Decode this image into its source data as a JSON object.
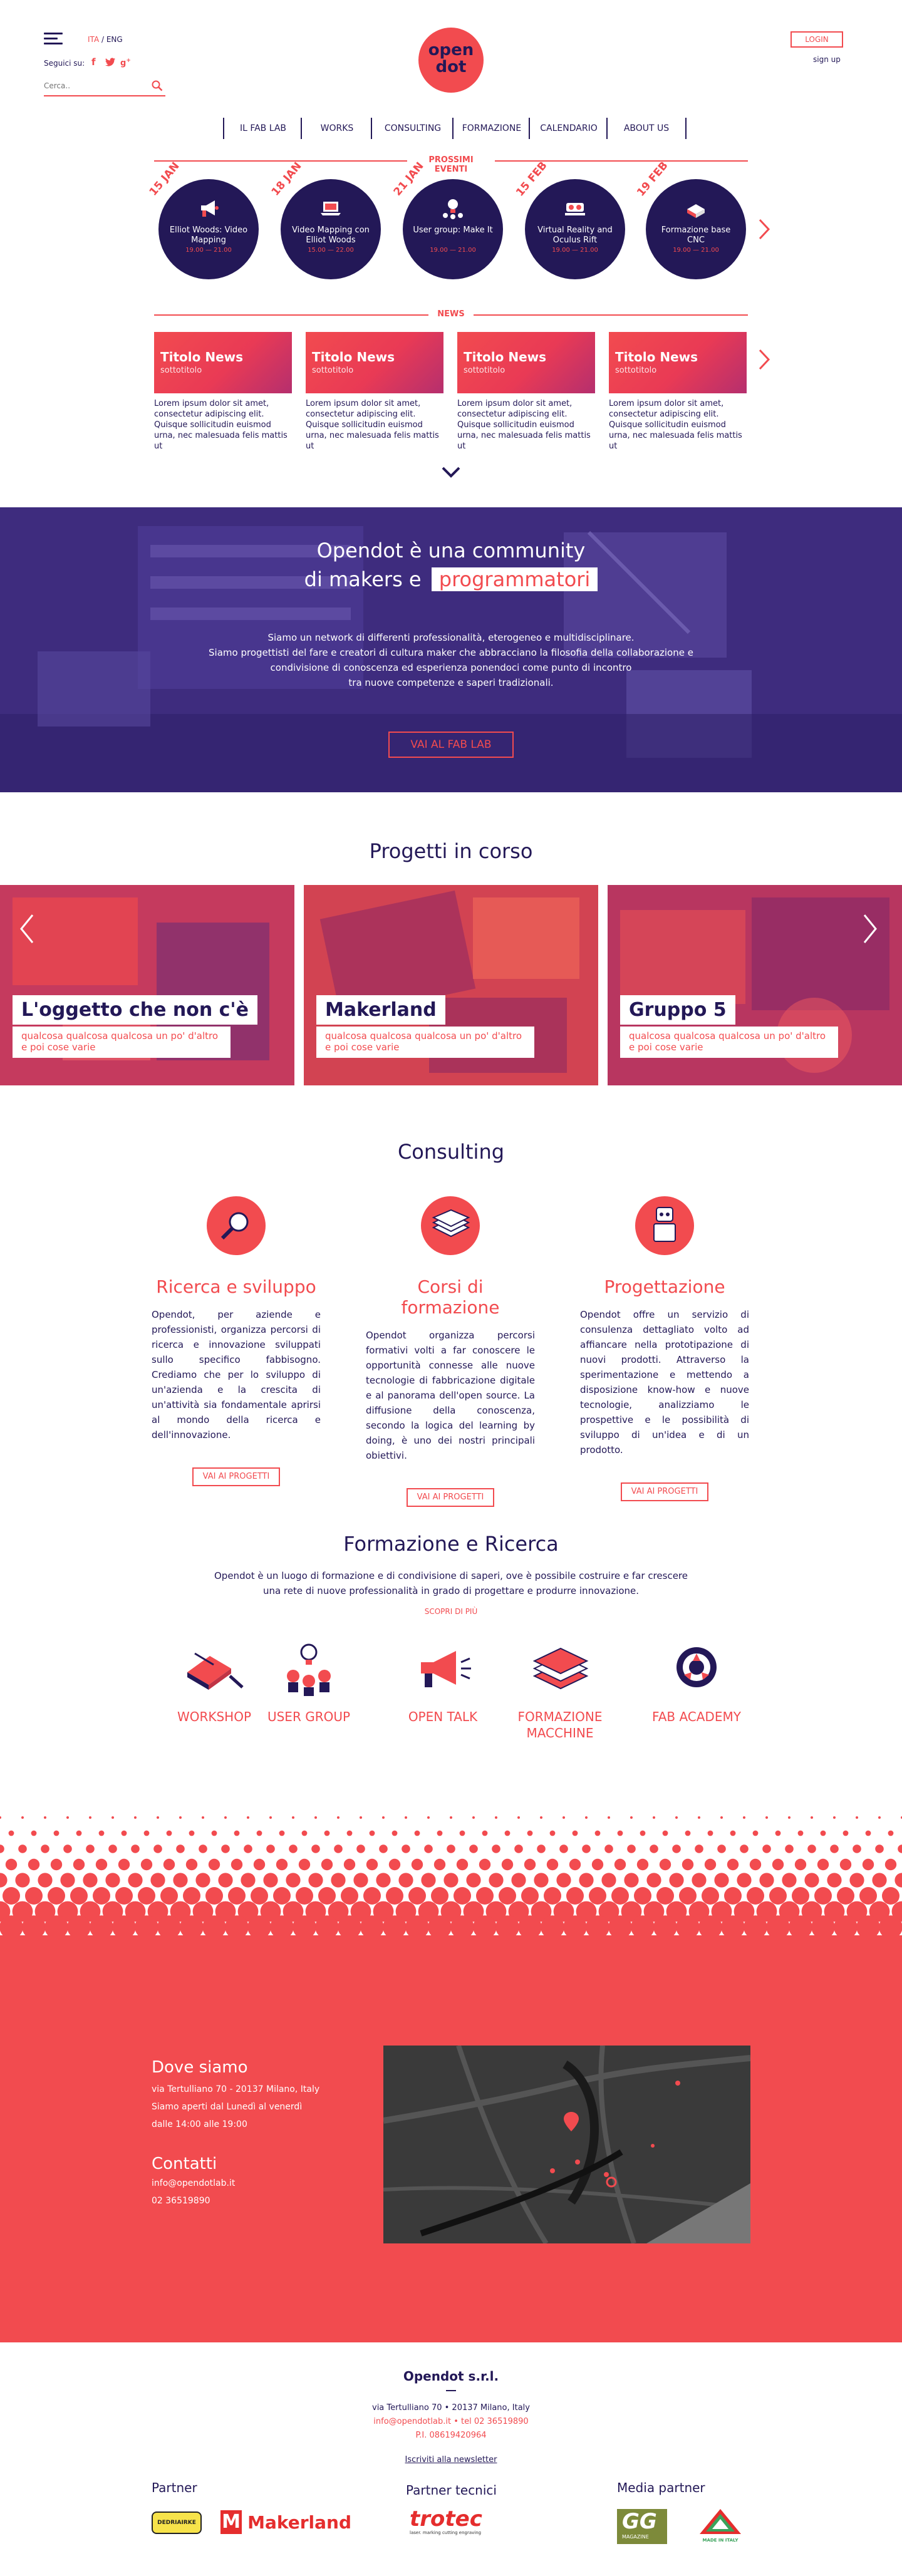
{
  "header": {
    "lang_ita": "ITA",
    "lang_sep": " / ",
    "lang_eng": "ENG",
    "follow_label": "Seguici su:",
    "search_placeholder": "Cerca..",
    "logo_line1": "open",
    "logo_line2": "dot",
    "login_label": "LOGIN",
    "signup_label": "sign up"
  },
  "nav": {
    "items": [
      "IL FAB LAB",
      "WORKS",
      "CONSULTING",
      "FORMAZIONE",
      "CALENDARIO",
      "ABOUT US"
    ]
  },
  "events": {
    "section_label": "PROSSIMI EVENTI",
    "items": [
      {
        "date": "15 JAN",
        "title": "Elliot Woods: Video Mapping",
        "time": "19.00 — 21.00"
      },
      {
        "date": "18 JAN",
        "title": "Video Mapping con Elliot Woods",
        "time": "15.00 — 22.00"
      },
      {
        "date": "21 JAN",
        "title": "User group: Make It",
        "time": "19.00 — 21.00"
      },
      {
        "date": "15 FEB",
        "title": "Virtual Reality and Oculus Rift",
        "time": "19.00 — 21.00"
      },
      {
        "date": "19 FEB",
        "title": "Formazione base CNC",
        "time": "19.00 — 21.00"
      }
    ]
  },
  "news": {
    "section_label": "NEWS",
    "items": [
      {
        "title": "Titolo News",
        "subtitle": "sottotitolo",
        "text": "Lorem ipsum dolor sit amet, consectetur adipiscing elit. Quisque sollicitudin euismod urna, nec malesuada felis mattis ut"
      },
      {
        "title": "Titolo News",
        "subtitle": "sottotitolo",
        "text": "Lorem ipsum dolor sit amet, consectetur adipiscing elit. Quisque sollicitudin euismod urna, nec malesuada felis mattis ut"
      },
      {
        "title": "Titolo News",
        "subtitle": "sottotitolo",
        "text": "Lorem ipsum dolor sit amet, consectetur adipiscing elit. Quisque sollicitudin euismod urna, nec malesuada felis mattis ut"
      },
      {
        "title": "Titolo News",
        "subtitle": "sottotitolo",
        "text": "Lorem ipsum dolor sit amet, consectetur adipiscing elit. Quisque sollicitudin euismod urna, nec malesuada felis mattis ut"
      }
    ]
  },
  "hero": {
    "title_line1": "Opendot è una community",
    "title_line2_prefix": "di makers e",
    "title_highlight": "programmatori",
    "text_line1": "Siamo un network di differenti professionalità, eterogeneo e multidisciplinare.",
    "text_line2": "Siamo progettisti del fare e creatori di cultura maker che abbracciano la filosofia della collaborazione e",
    "text_line3": "condivisione di conoscenza ed esperienza ponendoci come punto di incontro",
    "text_line4": "tra nuove competenze e saperi tradizionali.",
    "button_label": "VAI AL FAB LAB"
  },
  "projects": {
    "title": "Progetti in corso",
    "items": [
      {
        "name": "L'oggetto che non c'è",
        "desc": "qualcosa qualcosa qualcosa un po' d'altro e poi cose varie"
      },
      {
        "name": "Makerland",
        "desc": "qualcosa qualcosa qualcosa un po' d'altro e poi cose varie"
      },
      {
        "name": "Gruppo 5",
        "desc": "qualcosa qualcosa qualcosa un po' d'altro e poi cose varie"
      }
    ]
  },
  "consulting": {
    "title": "Consulting",
    "items": [
      {
        "title": "Ricerca e sviluppo",
        "text": "Opendot, per aziende e professionisti, organizza percorsi di ricerca e innovazione sviluppati sullo specifico fabbisogno. Crediamo che per lo sviluppo di un'azienda e la crescita di un'attività sia fondamentale aprirsi al mondo della ricerca e dell'innovazione.",
        "button": "VAI AI PROGETTI"
      },
      {
        "title": "Corsi di formazione",
        "text": "Opendot organizza percorsi formativi volti a far conoscere le opportunità connesse alle nuove tecnologie di fabbricazione digitale e al panorama dell'open source. La diffusione della conoscenza, secondo la logica del learning by doing, è uno dei nostri principali obiettivi.",
        "button": "VAI AI PROGETTI"
      },
      {
        "title": "Progettazione",
        "text": "Opendot offre un servizio di consulenza dettagliato volto ad affiancare nella prototipazione di nuovi prodotti. Attraverso la sperimentazione e mettendo a disposizione know-how e nuove tecnologie, analizziamo le prospettive e le possibilità di sviluppo di un'idea e di un prodotto.",
        "button": "VAI AI PROGETTI"
      }
    ]
  },
  "formazione": {
    "title": "Formazione e Ricerca",
    "text_line1": "Opendot è un luogo di formazione e di condivisione di saperi, ove è possibile costruire e far crescere",
    "text_line2": "una rete di nuove professionalità in grado di progettare e produrre innovazione.",
    "link_label": "SCOPRI DI PIÙ",
    "items": [
      {
        "label": "WORKSHOP"
      },
      {
        "label": "USER GROUP"
      },
      {
        "label": "OPEN TALK"
      },
      {
        "label": "FORMAZIONE MACCHINE"
      },
      {
        "label": "FAB ACADEMY"
      }
    ]
  },
  "contact": {
    "where_title": "Dove siamo",
    "address": "via Tertulliano 70 - 20137 Milano, Italy",
    "hours_line1": "Siamo aperti dal Lunedì al venerdì",
    "hours_line2": "dalle 14:00 alle 19:00",
    "contacts_title": "Contatti",
    "email": "info@opendotlab.it",
    "phone": "02 36519890"
  },
  "footer": {
    "company": "Opendot s.r.l.",
    "address": "via Tertulliano 70 • 20137 Milano, Italy",
    "email_phone": "info@opendotlab.it • tel 02 36519890",
    "vat": "P.I. 08619420964",
    "newsletter": "Iscriviti alla newsletter",
    "partner_title": "Partner",
    "tech_partner_title": "Partner tecnici",
    "media_partner_title": "Media partner",
    "partner1": "DEDRIAIRKE",
    "partner2": "Makerland",
    "tech_partner": "trotec",
    "tech_partner_sub": "laser. marking cutting engraving",
    "media1": "GG",
    "media1_sub": "MAGAZINE",
    "media2_sub": "MADE IN ITALY"
  },
  "colors": {
    "brand_red": "#f24b4f",
    "brand_navy": "#231857",
    "hero_purple": "#4b3890"
  }
}
